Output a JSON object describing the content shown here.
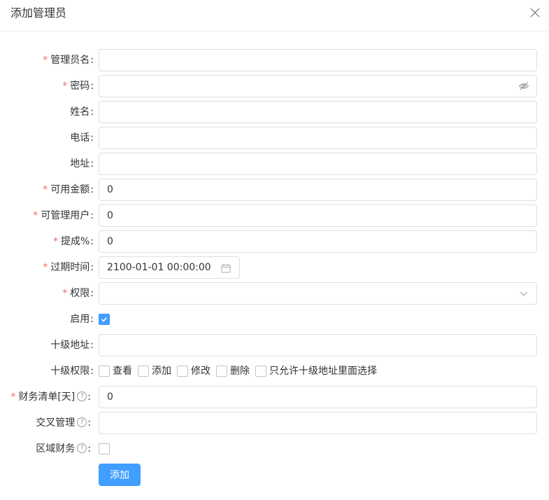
{
  "dialog": {
    "title": "添加管理员"
  },
  "form": {
    "admin_name": {
      "label": "管理员名",
      "required": "*",
      "value": ""
    },
    "password": {
      "label": "密码",
      "required": "*",
      "value": ""
    },
    "full_name": {
      "label": "姓名",
      "value": ""
    },
    "phone": {
      "label": "电话",
      "value": ""
    },
    "address": {
      "label": "地址",
      "value": ""
    },
    "available_amount": {
      "label": "可用金额",
      "required": "*",
      "value": "0"
    },
    "manageable_users": {
      "label": "可管理用户",
      "required": "*",
      "value": "0"
    },
    "commission": {
      "label": "提成%",
      "required": "*",
      "value": "0"
    },
    "expire_time": {
      "label": "过期时间",
      "required": "*",
      "value": "2100-01-01 00:00:00"
    },
    "permission": {
      "label": "权限",
      "required": "*",
      "value": ""
    },
    "enabled": {
      "label": "启用",
      "checked": true
    },
    "level10_address": {
      "label": "十级地址",
      "value": ""
    },
    "level10_permission": {
      "label": "十级权限",
      "options": [
        "查看",
        "添加",
        "修改",
        "删除",
        "只允许十级地址里面选择"
      ]
    },
    "finance_days": {
      "label": "财务清单[天]",
      "required": "*",
      "help": "?",
      "value": "0"
    },
    "cross_management": {
      "label": "交叉管理",
      "help": "?",
      "value": ""
    },
    "regional_finance": {
      "label": "区域财务",
      "help": "?",
      "checked": false
    },
    "colon": ":"
  },
  "submit_label": "添加",
  "colors": {
    "primary": "#409eff",
    "required": "#f56c6c",
    "border": "#dcdfe6"
  }
}
